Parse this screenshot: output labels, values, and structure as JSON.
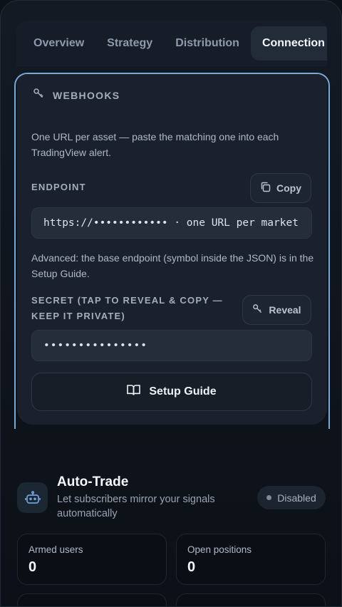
{
  "header": {
    "faded_label": ""
  },
  "tabs": [
    {
      "label": "Overview",
      "active": false
    },
    {
      "label": "Strategy",
      "active": false
    },
    {
      "label": "Distribution",
      "active": false
    },
    {
      "label": "Connection",
      "active": true
    }
  ],
  "webhooks": {
    "section_title": "WEBHOOKS",
    "icon": "key-icon",
    "description": "One URL per asset — paste the matching one into each TradingView alert.",
    "endpoint_label": "ENDPOINT",
    "copy_label": "Copy",
    "endpoint_value": "https://•••••••••••• · one URL per market",
    "advanced_note": "Advanced: the base endpoint (symbol inside the JSON) is in the Setup Guide.",
    "secret_label": "SECRET (TAP TO REVEAL & COPY — KEEP IT PRIVATE)",
    "reveal_label": "Reveal",
    "secret_value": "•••••••••••••••",
    "setup_guide_label": "Setup Guide"
  },
  "autotrade": {
    "title": "Auto-Trade",
    "subtitle": "Let subscribers mirror your signals automatically",
    "icon": "robot-icon",
    "status": "Disabled",
    "stats": [
      {
        "label": "Armed users",
        "value": "0"
      },
      {
        "label": "Open positions",
        "value": "0"
      }
    ]
  },
  "colors": {
    "accent_border": "#7ba7d6",
    "background": "#0d1118",
    "card": "#1a212c"
  }
}
